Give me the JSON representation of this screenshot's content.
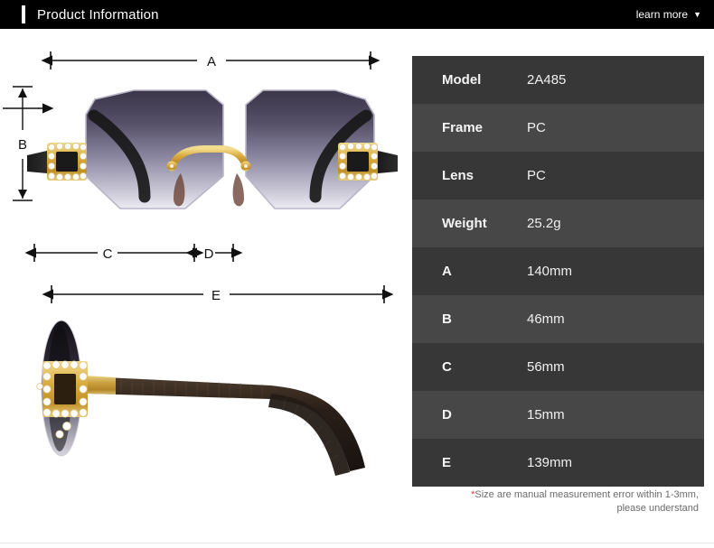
{
  "header": {
    "title": "Product Information",
    "learn_more_label": "learn more",
    "caret_icon": "chevron-down-icon",
    "background_color": "#000000",
    "text_color": "#ffffff",
    "accent_color": "#ffffff"
  },
  "illustration": {
    "product": "rimless octagonal rhinestone sunglasses",
    "views": [
      {
        "name": "front-view",
        "description": "front view of sunglasses with gradient purple-grey octagonal lenses, gold bridge and rhinestone hinge ornaments"
      },
      {
        "name": "side-view",
        "description": "side profile of sunglasses showing dark lens, gold rhinestone hinge decoration and dark brown textured temple arms"
      }
    ],
    "dimension_markers": [
      {
        "label": "A",
        "orientation": "horizontal",
        "view": "front-view",
        "measures": "total frame width"
      },
      {
        "label": "B",
        "orientation": "vertical",
        "view": "front-view",
        "measures": "lens height"
      },
      {
        "label": "C",
        "orientation": "horizontal",
        "view": "front-view",
        "measures": "lens width"
      },
      {
        "label": "D",
        "orientation": "horizontal",
        "view": "front-view",
        "measures": "bridge width"
      },
      {
        "label": "E",
        "orientation": "horizontal",
        "view": "side-view",
        "measures": "temple arm length"
      }
    ]
  },
  "spec_table": {
    "rows": [
      {
        "key": "Model",
        "value": "2A485"
      },
      {
        "key": "Frame",
        "value": "PC"
      },
      {
        "key": "Lens",
        "value": "PC"
      },
      {
        "key": "Weight",
        "value": "25.2g"
      },
      {
        "key": "A",
        "value": "140mm"
      },
      {
        "key": "B",
        "value": "46mm"
      },
      {
        "key": "C",
        "value": "56mm"
      },
      {
        "key": "D",
        "value": "15mm"
      },
      {
        "key": "E",
        "value": "139mm"
      }
    ],
    "row_color_dark": "#373737",
    "row_color_light": "#474747",
    "text_color": "#f2f2f2"
  },
  "note": {
    "star": "*",
    "line1": "Size are manual measurement error within 1-3mm,",
    "line2": "please understand",
    "star_color": "#e23b2e",
    "text_color": "#6b6b6b"
  }
}
